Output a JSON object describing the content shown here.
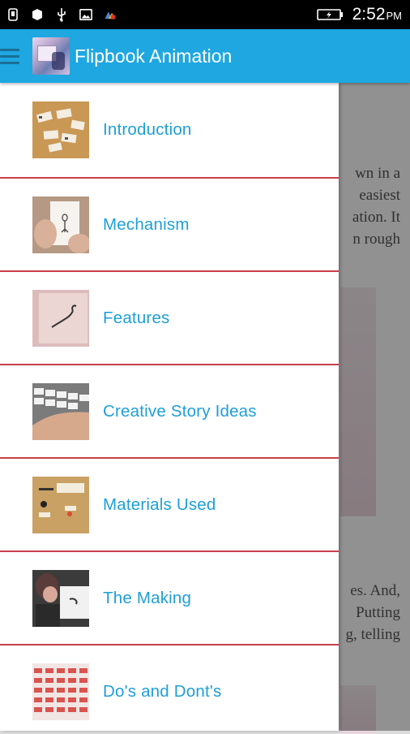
{
  "status_bar": {
    "time": "2:52",
    "ampm": "PM",
    "icons": [
      "sim-card-icon",
      "shield-icon",
      "usb-icon",
      "image-icon",
      "app-update-icon",
      "battery-charging-icon"
    ]
  },
  "app_bar": {
    "title": "Flipbook Animation",
    "menu_icon": "hamburger-icon"
  },
  "background_text": {
    "line1": "wn in a",
    "line2": "easiest",
    "line3": "ation. It",
    "line4": "n rough",
    "line5": "es. And,",
    "line6": "Putting",
    "line7": "g, telling"
  },
  "drawer": {
    "items": [
      {
        "label": "Introduction"
      },
      {
        "label": "Mechanism"
      },
      {
        "label": "Features"
      },
      {
        "label": "Creative Story Ideas"
      },
      {
        "label": "Materials Used"
      },
      {
        "label": "The Making"
      },
      {
        "label": "Do's and Dont's"
      }
    ]
  },
  "colors": {
    "app_bar": "#1ea7e1",
    "menu_text": "#1e9fd8",
    "divider": "#c8404a"
  }
}
